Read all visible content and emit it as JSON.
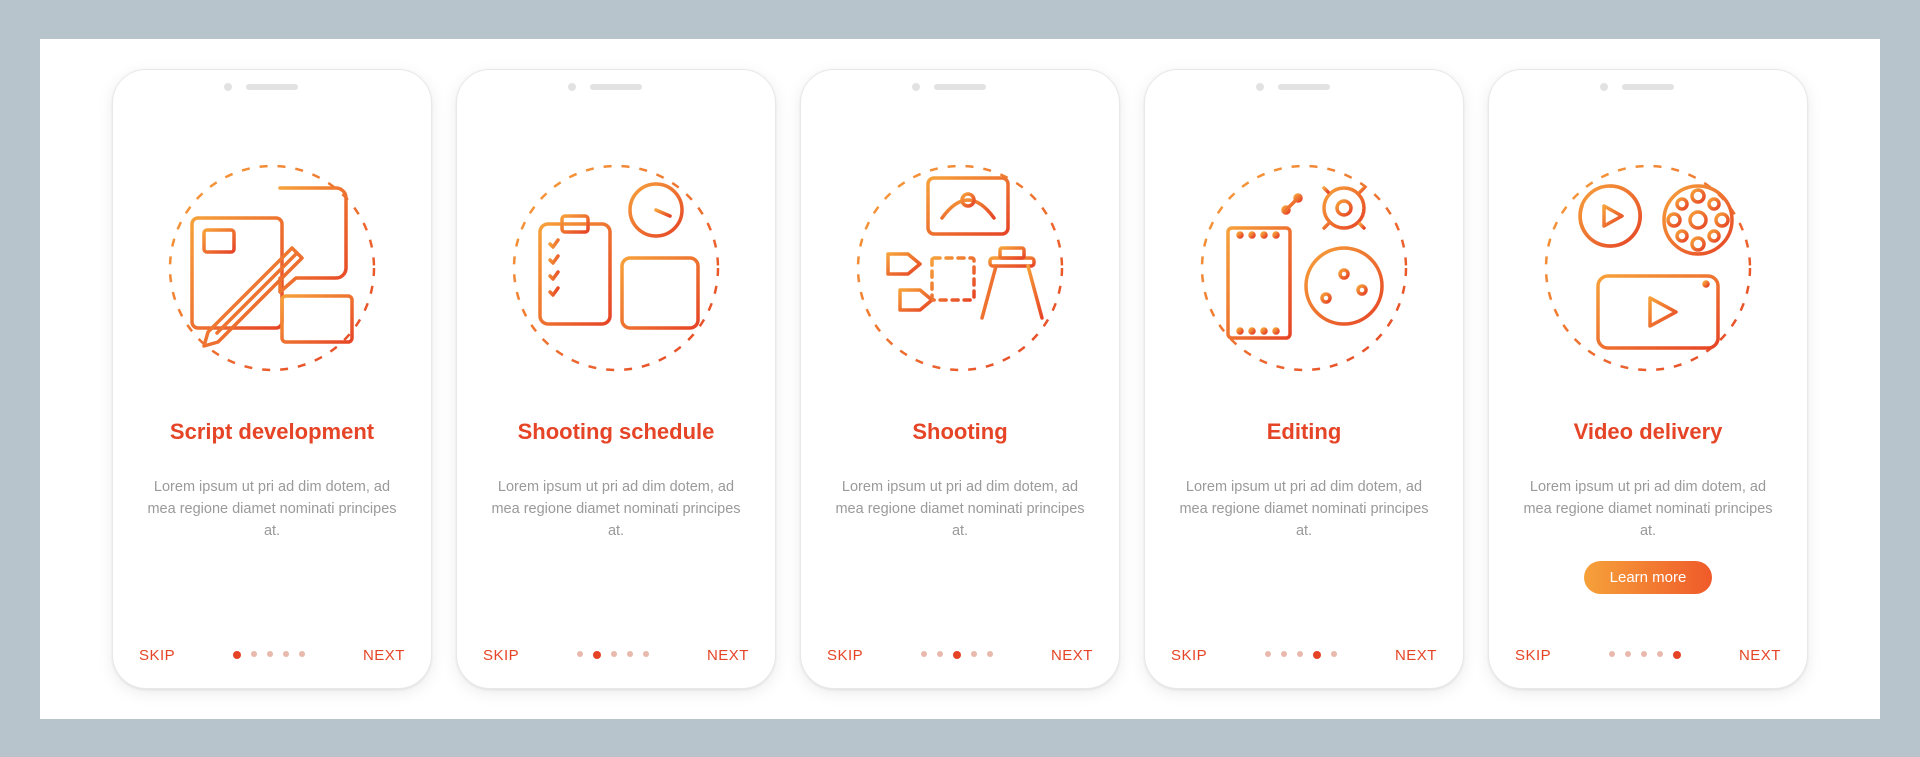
{
  "nav": {
    "skip": "SKIP",
    "next": "NEXT"
  },
  "cta_label": "Learn more",
  "description": "Lorem ipsum ut pri ad dim dotem, ad mea regione diamet nominati principes at.",
  "screens": [
    {
      "title": "Script development",
      "icon": "script-dev-icon"
    },
    {
      "title": "Shooting schedule",
      "icon": "schedule-icon"
    },
    {
      "title": "Shooting",
      "icon": "shooting-icon"
    },
    {
      "title": "Editing",
      "icon": "editing-icon"
    },
    {
      "title": "Video delivery",
      "icon": "delivery-icon",
      "cta": true
    }
  ],
  "colors": {
    "accent": "#e64426",
    "grad_a": "#f6a13a",
    "grad_b": "#ef5a2a"
  }
}
